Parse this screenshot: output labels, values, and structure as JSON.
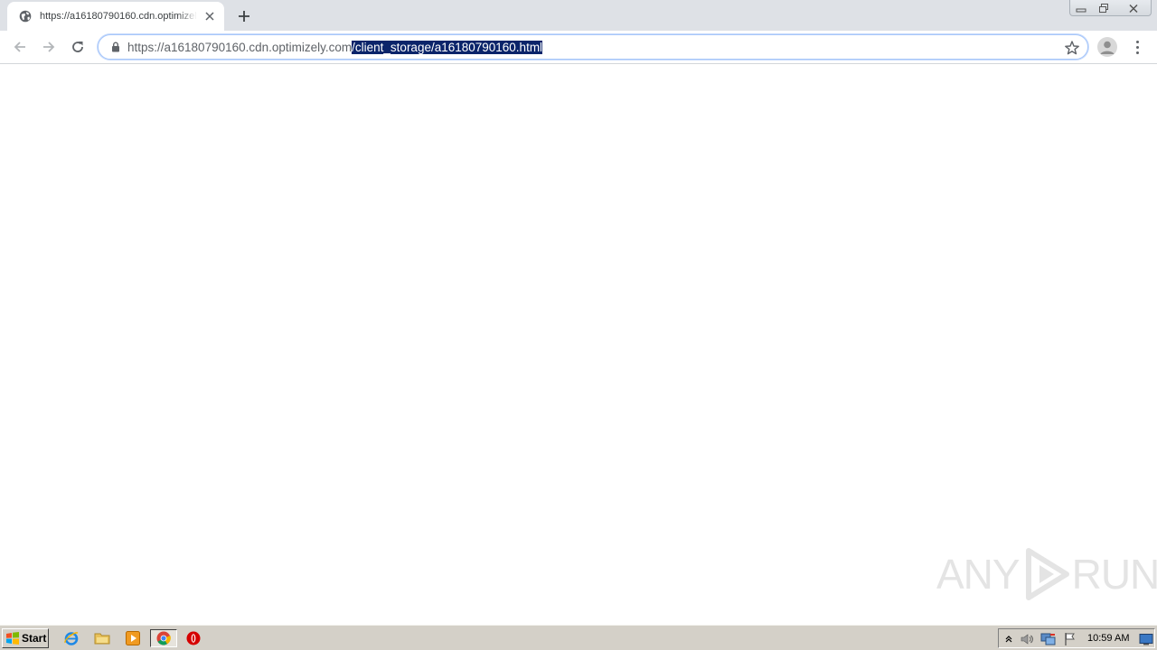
{
  "browser": {
    "tab": {
      "title": "https://a16180790160.cdn.optimizely.com/client_storage/a16180790160.html",
      "favicon": "globe-icon"
    },
    "address_bar": {
      "url_host": "https://a16180790160.cdn.optimizely.com",
      "url_path_selected": "/client_storage/a16180790160.html",
      "lock_icon": "lock-icon",
      "selection_color": "#0a246a"
    },
    "icons": {
      "back": "arrow-left-icon",
      "forward": "arrow-right-icon",
      "reload": "reload-icon",
      "bookmark": "star-icon",
      "profile": "avatar-icon",
      "menu": "kebab-menu-icon",
      "new_tab": "plus-icon",
      "close_tab": "close-icon"
    }
  },
  "watermark": {
    "left": "ANY",
    "right": "RUN"
  },
  "taskbar": {
    "start_label": "Start",
    "pinned": [
      "internet-explorer-icon",
      "folder-icon",
      "media-player-icon",
      "chrome-icon",
      "opera-icon"
    ],
    "clock": "10:59 AM"
  },
  "colors": {
    "tab_strip": "#dee1e6",
    "taskbar": "#d4d0c8",
    "omnibox_focus": "#a8c7fa"
  }
}
